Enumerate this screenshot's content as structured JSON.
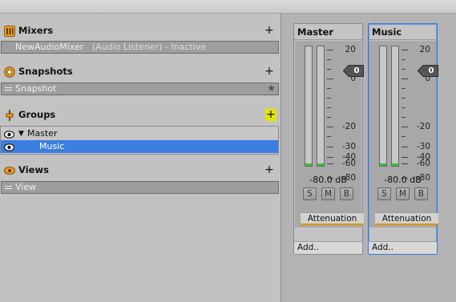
{
  "sections": {
    "mixers": {
      "title": "Mixers",
      "add": "+"
    },
    "snapshots": {
      "title": "Snapshots",
      "add": "+"
    },
    "groups": {
      "title": "Groups",
      "add": "+"
    },
    "views": {
      "title": "Views",
      "add": "+"
    }
  },
  "mixers": {
    "name": "NewAudioMixer",
    "status": "(Audio Listener) - Inactive"
  },
  "snapshots": {
    "name": "Snapshot",
    "star": "★"
  },
  "groups": {
    "master": {
      "tri": "▼",
      "label": "Master"
    },
    "music": {
      "label": "Music"
    }
  },
  "views": {
    "name": "View"
  },
  "colors": {
    "selection": "#3c7de0",
    "accent_orange": "#e09500",
    "meter_green": "#3dbf3d",
    "highlight_yellow": "#e3e500"
  },
  "scale_labels": [
    "20",
    "0",
    "-20",
    "-30",
    "-40",
    "-60",
    "-80"
  ],
  "strips": [
    {
      "title": "Master",
      "db": "-80.0 dB",
      "attenuation_value": "0",
      "solo": "S",
      "mute": "M",
      "bypass": "B",
      "effect": "Attenuation",
      "add": "Add..",
      "meter_level": 0.02
    },
    {
      "title": "Music",
      "db": "-80.0 dB",
      "attenuation_value": "0",
      "solo": "S",
      "mute": "M",
      "bypass": "B",
      "effect": "Attenuation",
      "add": "Add..",
      "meter_level": 0.02
    }
  ]
}
